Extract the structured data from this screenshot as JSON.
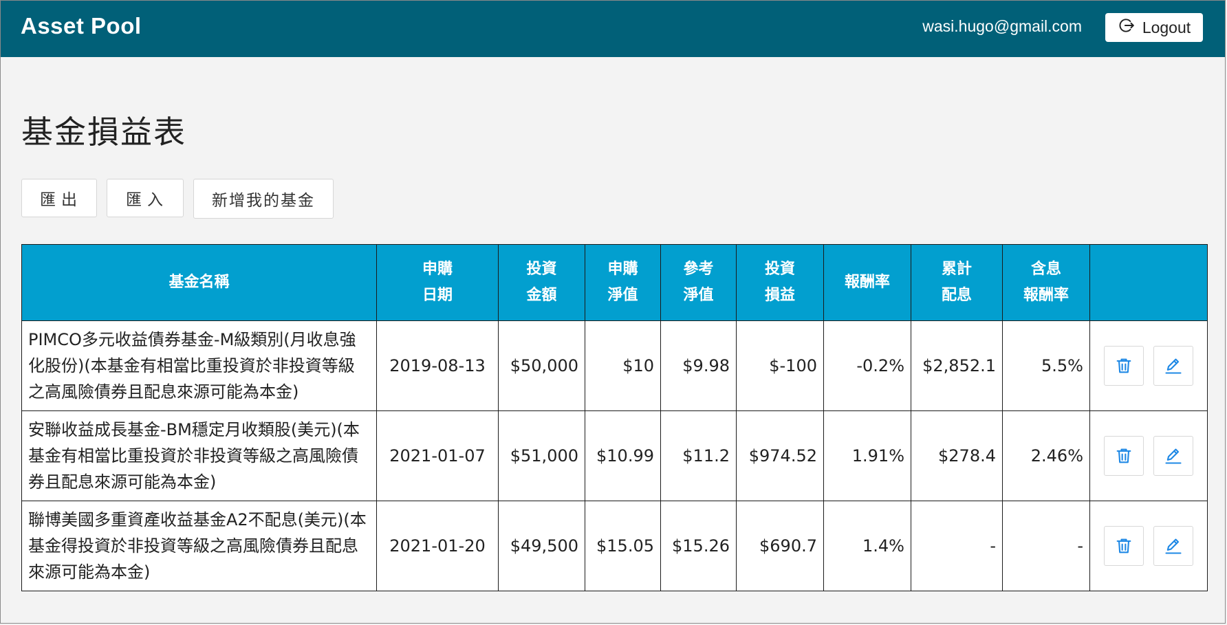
{
  "app": {
    "title": "Asset Pool"
  },
  "header": {
    "user_email": "wasi.hugo@gmail.com",
    "logout_label": "Logout"
  },
  "page": {
    "title": "基金損益表"
  },
  "actions": {
    "export_label": "匯出",
    "import_label": "匯入",
    "add_label": "新增我的基金"
  },
  "table": {
    "headers": {
      "name": "基金名稱",
      "date_1": "申購",
      "date_2": "日期",
      "amount_1": "投資",
      "amount_2": "金額",
      "nav_1": "申購",
      "nav_2": "淨值",
      "ref_1": "參考",
      "ref_2": "淨值",
      "pnl_1": "投資",
      "pnl_2": "損益",
      "ret": "報酬率",
      "div_1": "累計",
      "div_2": "配息",
      "tot_1": "含息",
      "tot_2": "報酬率"
    },
    "rows": [
      {
        "name": "PIMCO多元收益債券基金-M級類別(月收息強化股份)(本基金有相當比重投資於非投資等級之高風險債券且配息來源可能為本金)",
        "date": "2019-08-13",
        "amount": "$50,000",
        "nav": "$10",
        "ref_nav": "$9.98",
        "pnl": "$-100",
        "return": "-0.2%",
        "dividend": "$2,852.1",
        "total_return": "5.5%"
      },
      {
        "name": "安聯收益成長基金-BM穩定月收類股(美元)(本基金有相當比重投資於非投資等級之高風險債券且配息來源可能為本金)",
        "date": "2021-01-07",
        "amount": "$51,000",
        "nav": "$10.99",
        "ref_nav": "$11.2",
        "pnl": "$974.52",
        "return": "1.91%",
        "dividend": "$278.4",
        "total_return": "2.46%"
      },
      {
        "name": "聯博美國多重資產收益基金A2不配息(美元)(本基金得投資於非投資等級之高風險債券且配息來源可能為本金)",
        "date": "2021-01-20",
        "amount": "$49,500",
        "nav": "$15.05",
        "ref_nav": "$15.26",
        "pnl": "$690.7",
        "return": "1.4%",
        "dividend": "-",
        "total_return": "-"
      }
    ]
  },
  "colors": {
    "topbar": "#016078",
    "table_header": "#029fcf",
    "negative": "#ee0000",
    "positive": "#0000e0",
    "icon_blue": "#1e88e5"
  },
  "icons": {
    "logout": "logout-icon",
    "delete": "trash-icon",
    "edit": "pencil-icon"
  }
}
